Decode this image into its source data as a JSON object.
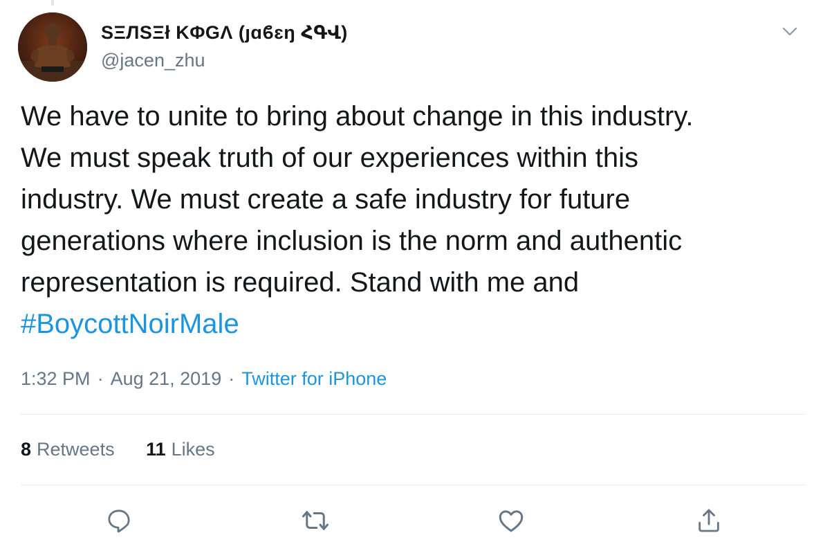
{
  "tweet": {
    "author": {
      "display_name": "SΞЛSΞł KΦGΛ (ȷɑϐɛŋ ՀԳՎ)",
      "handle": "@jacen_zhu",
      "avatar_icon": "profile-photo"
    },
    "text_lines": [
      "We have to unite to bring about change in this industry.",
      "We must speak truth of our experiences within this",
      "industry. We must create a safe industry for future",
      "generations where inclusion is the norm and authentic",
      "representation is required. Stand with me and"
    ],
    "hashtag": "#BoycottNoirMale",
    "time": "1:32 PM",
    "separator": "·",
    "date": "Aug 21, 2019",
    "source": "Twitter for iPhone",
    "retweets_count": "8",
    "retweets_label": "Retweets",
    "likes_count": "11",
    "likes_label": "Likes"
  },
  "actions": [
    {
      "name": "reply",
      "icon": "comment-icon"
    },
    {
      "name": "retweet",
      "icon": "retweet-icon"
    },
    {
      "name": "like",
      "icon": "heart-icon"
    },
    {
      "name": "share",
      "icon": "share-icon"
    }
  ],
  "colors": {
    "link": "#1b95e0",
    "secondary_text": "#657786",
    "primary_text": "#14171a",
    "divider": "#e6ecf0"
  }
}
